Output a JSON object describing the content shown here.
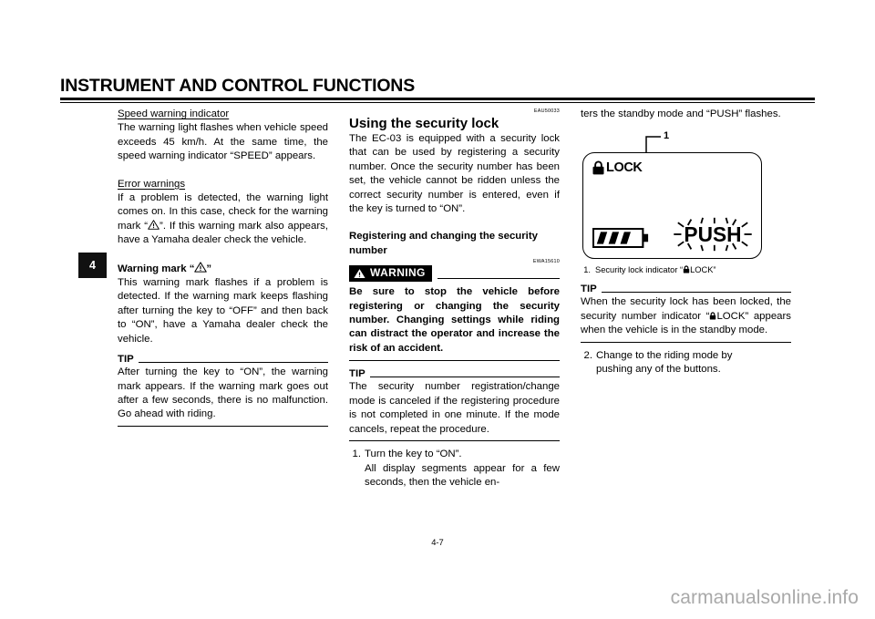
{
  "header": {
    "title": "INSTRUMENT AND CONTROL FUNCTIONS"
  },
  "chapter_tab": {
    "number": "4"
  },
  "left_column": {
    "speed_warning": {
      "heading": "Speed warning indicator",
      "body": "The warning light flashes when vehicle speed exceeds 45 km/h. At the same time, the speed warning indicator “SPEED” appears."
    },
    "error_warnings": {
      "heading": "Error warnings",
      "body_part1": "If a problem is detected, the warning light comes on. In this case, check for the warning mark “",
      "body_part2": "”. If this warning mark also appears, have a Yamaha dealer check the vehicle."
    },
    "warning_mark": {
      "heading_part1": "Warning mark “",
      "heading_part2": "”",
      "body": "This warning mark flashes if a problem is detected. If the warning mark keeps flashing after turning the key to “OFF” and then back to “ON”, have a Yamaha dealer check the vehicle."
    },
    "tip": {
      "label": "TIP",
      "body": "After turning the key to “ON”, the warning mark appears. If the warning mark goes out after a few seconds, there is no malfunction. Go ahead with riding."
    }
  },
  "middle_column": {
    "ref_code_1": "EAU50033",
    "security_lock": {
      "heading": "Using the security lock",
      "body": "The EC-03 is equipped with a security lock that can be used by registering a security number. Once the security number has been set, the vehicle cannot be ridden unless the correct security number is entered, even if the key is turned to “ON”."
    },
    "registering": {
      "heading": "Registering and changing the security number"
    },
    "ref_code_2": "EWA15610",
    "warning": {
      "label": "WARNING",
      "icon": "warning-triangle-icon",
      "body": "Be sure to stop the vehicle before registering or changing the security number. Changing settings while riding can distract the operator and increase the risk of an accident."
    },
    "tip": {
      "label": "TIP",
      "body": "The security number registration/change mode is canceled if the registering procedure is not completed in one minute. If the mode cancels, repeat the procedure."
    },
    "steps": [
      {
        "num": "1.",
        "line1": "Turn the key to “ON”.",
        "line2": "All display segments appear for a few seconds, then the vehicle en-"
      }
    ]
  },
  "right_column": {
    "continuation": "ters the standby mode and “PUSH” flashes.",
    "figure": {
      "callout": "1",
      "lcd": {
        "lock_label": "LOCK",
        "lock_icon": "padlock-icon",
        "battery_icon": "battery-level-icon",
        "battery_segments": 3,
        "battery_segments_total": 4,
        "push_text": "PUSH",
        "push_state": "flashing"
      },
      "caption": {
        "num": "1.",
        "text_part1": "Security lock indicator “",
        "text_part2": "LOCK”"
      }
    },
    "tip": {
      "label": "TIP",
      "body_part1": "When the security lock has been locked, the security number indicator “",
      "body_part2": "LOCK” appears when the vehicle is in the standby mode."
    },
    "steps": [
      {
        "num": "2.",
        "line1": "Change to the riding mode by",
        "line2": "pushing any of the buttons."
      }
    ]
  },
  "footer": {
    "page_number": "4-7",
    "watermark": "carmanualsonline.info"
  }
}
